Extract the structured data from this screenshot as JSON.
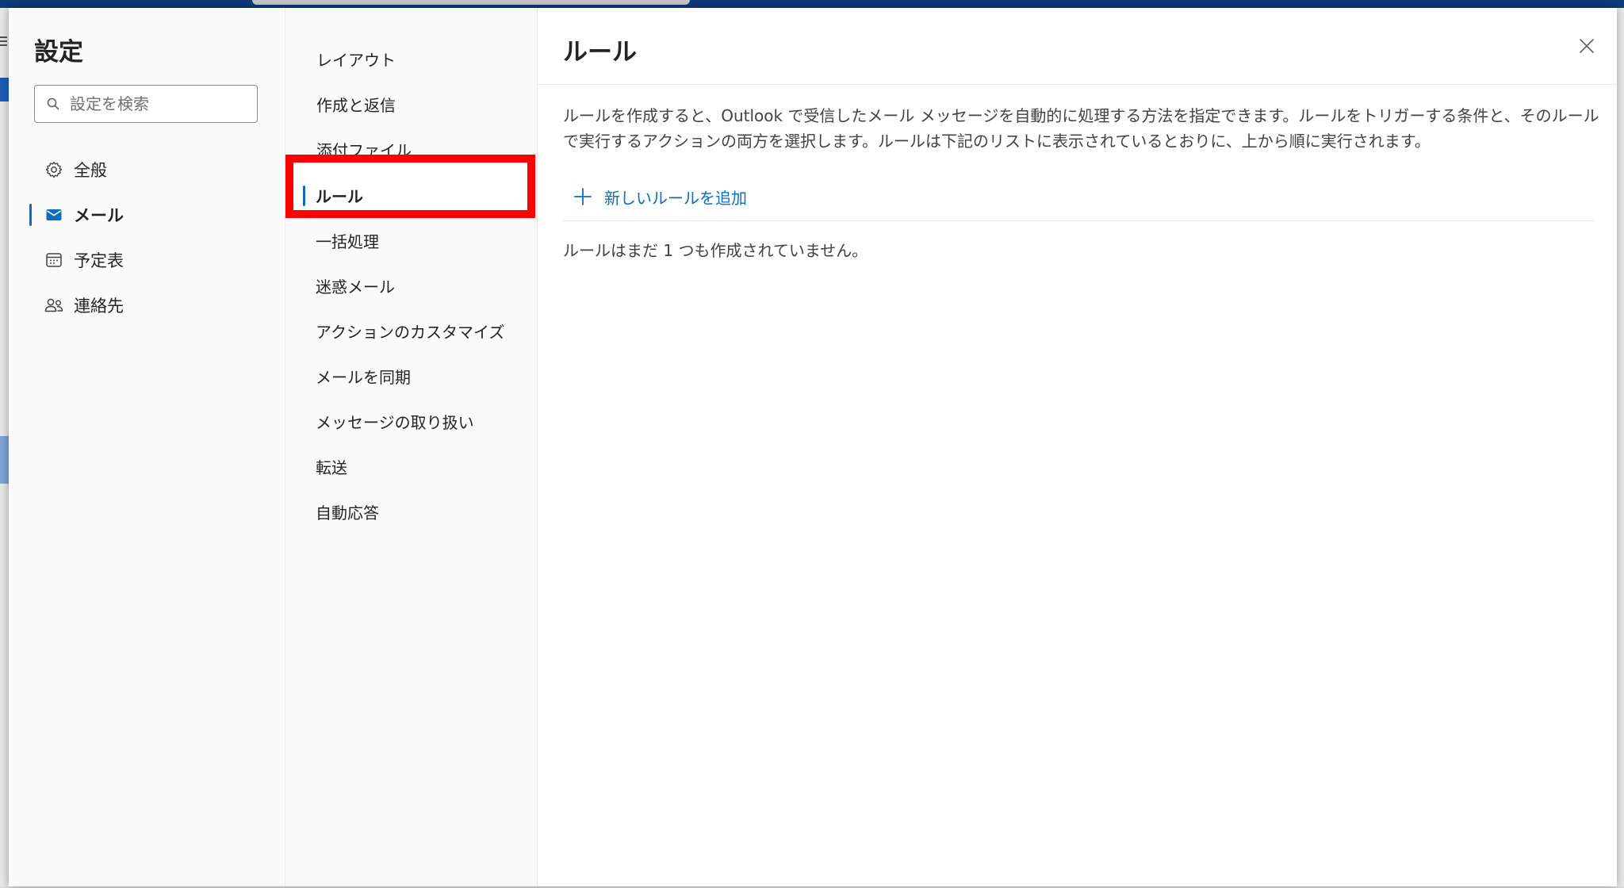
{
  "settings": {
    "title": "設定",
    "search_placeholder": "設定を検索"
  },
  "categories": [
    {
      "label": "全般",
      "icon": "gear-icon",
      "selected": false
    },
    {
      "label": "メール",
      "icon": "mail-icon",
      "selected": true
    },
    {
      "label": "予定表",
      "icon": "calendar-icon",
      "selected": false
    },
    {
      "label": "連絡先",
      "icon": "people-icon",
      "selected": false
    }
  ],
  "mail_nav": {
    "items": [
      {
        "label": "レイアウト",
        "selected": false
      },
      {
        "label": "作成と返信",
        "selected": false
      },
      {
        "label": "添付ファイル",
        "selected": false
      },
      {
        "label": "ルール",
        "selected": true
      },
      {
        "label": "一括処理",
        "selected": false
      },
      {
        "label": "迷惑メール",
        "selected": false
      },
      {
        "label": "アクションのカスタマイズ",
        "selected": false
      },
      {
        "label": "メールを同期",
        "selected": false
      },
      {
        "label": "メッセージの取り扱い",
        "selected": false
      },
      {
        "label": "転送",
        "selected": false
      },
      {
        "label": "自動応答",
        "selected": false
      }
    ]
  },
  "content": {
    "title": "ルール",
    "description": "ルールを作成すると、Outlook で受信したメール メッセージを自動的に処理する方法を指定できます。ルールをトリガーする条件と、そのルールで実行するアクションの両方を選択します。ルールは下記のリストに表示されているとおりに、上から順に実行されます。",
    "add_rule_label": "新しいルールを追加",
    "empty_text": "ルールはまだ 1 つも作成されていません。"
  },
  "colors": {
    "accent": "#0f6cbd",
    "highlight": "#ff0000"
  }
}
